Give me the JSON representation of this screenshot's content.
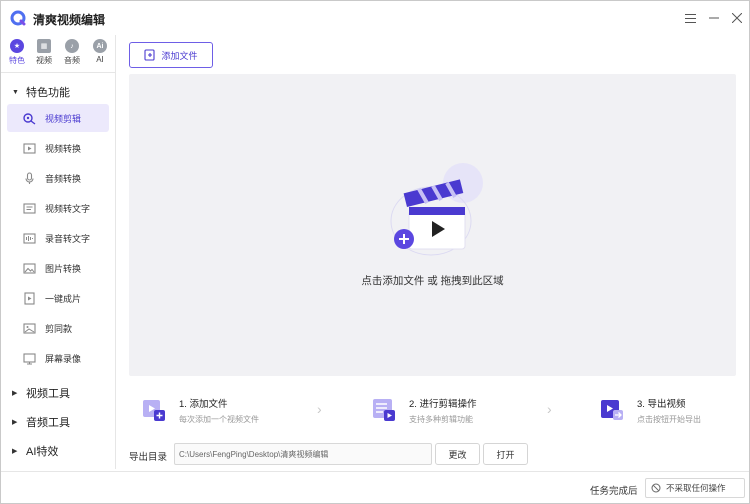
{
  "app": {
    "title": "清爽视频编辑"
  },
  "window_controls": {
    "menu": "☰",
    "minimize": "—",
    "close": "✕"
  },
  "top_tabs": [
    {
      "label": "特色",
      "icon": "star-icon",
      "glyph": "★",
      "active": true
    },
    {
      "label": "视频",
      "icon": "film-icon",
      "glyph": "▦",
      "active": false
    },
    {
      "label": "音频",
      "icon": "music-icon",
      "glyph": "♪",
      "active": false
    },
    {
      "label": "AI",
      "icon": "ai-icon",
      "glyph": "Ai",
      "active": false
    }
  ],
  "sidebar": {
    "groups": [
      {
        "label": "特色功能",
        "expanded": true
      },
      {
        "label": "视频工具",
        "expanded": false
      },
      {
        "label": "音频工具",
        "expanded": false
      },
      {
        "label": "AI特效",
        "expanded": false
      }
    ],
    "items": [
      {
        "label": "视频剪辑",
        "icon": "video-edit-icon",
        "active": true
      },
      {
        "label": "视频转换",
        "icon": "video-convert-icon",
        "active": false
      },
      {
        "label": "音频转换",
        "icon": "microphone-icon",
        "active": false
      },
      {
        "label": "视频转文字",
        "icon": "video-to-text-icon",
        "active": false
      },
      {
        "label": "录音转文字",
        "icon": "audio-to-text-icon",
        "active": false
      },
      {
        "label": "图片转换",
        "icon": "image-icon",
        "active": false
      },
      {
        "label": "一键成片",
        "icon": "one-click-icon",
        "active": false
      },
      {
        "label": "剪同款",
        "icon": "template-icon",
        "active": false
      },
      {
        "label": "屏幕录像",
        "icon": "screen-record-icon",
        "active": false
      }
    ]
  },
  "toolbar": {
    "add_file_label": "添加文件"
  },
  "dropzone": {
    "hint": "点击添加文件 或 拖拽到此区域"
  },
  "steps": [
    {
      "title": "1. 添加文件",
      "desc": "每次添加一个视频文件",
      "icon": "add-video-icon"
    },
    {
      "title": "2. 进行剪辑操作",
      "desc": "支持多种剪辑功能",
      "icon": "edit-list-icon"
    },
    {
      "title": "3. 导出视频",
      "desc": "点击按钮开始导出",
      "icon": "export-video-icon"
    }
  ],
  "export": {
    "label": "导出目录",
    "path": "C:\\Users\\FengPing\\Desktop\\清爽视频编辑",
    "change_label": "更改",
    "open_label": "打开"
  },
  "status": {
    "after_label": "任务完成后",
    "after_value": "不采取任何操作"
  },
  "colors": {
    "accent": "#5b47e0",
    "accent_light": "#ece9fc",
    "dropzone_bg": "#f1f1f4"
  }
}
